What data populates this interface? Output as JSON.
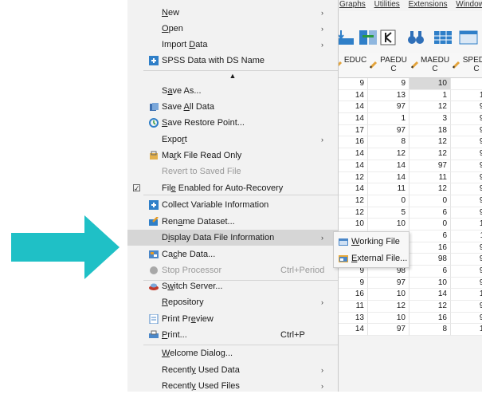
{
  "menu": {
    "items": [
      {
        "label": "New",
        "sub": true
      },
      {
        "label": "Open",
        "sub": true
      },
      {
        "label": "Import Data",
        "sub": true
      },
      {
        "label": "SPSS Data with DS Name",
        "icon": "spss-icon"
      },
      {
        "label": "Save As..."
      },
      {
        "label": "Save All Data",
        "icon": "save-all-icon"
      },
      {
        "label": "Save Restore Point...",
        "icon": "restore-point-icon"
      },
      {
        "label": "Export",
        "sub": true
      },
      {
        "label": "Mark File Read Only",
        "icon": "read-only-icon"
      },
      {
        "label": "Revert to Saved File",
        "disabled": true
      },
      {
        "label": "File Enabled for Auto-Recovery",
        "checked": true
      },
      {
        "label": "Collect Variable Information",
        "icon": "collect-info-icon"
      },
      {
        "label": "Rename Dataset...",
        "icon": "rename-icon"
      },
      {
        "label": "Display Data File Information",
        "sub": true,
        "highlight": true
      },
      {
        "label": "Cache Data...",
        "icon": "cache-icon"
      },
      {
        "label": "Stop Processor",
        "shortcut": "Ctrl+Period",
        "disabled": true,
        "icon": "stop-icon"
      },
      {
        "label": "Switch Server...",
        "icon": "server-icon"
      },
      {
        "label": "Repository",
        "sub": true
      },
      {
        "label": "Print Preview",
        "icon": "print-preview-icon"
      },
      {
        "label": "Print...",
        "shortcut": "Ctrl+P",
        "icon": "print-icon"
      },
      {
        "label": "Welcome Dialog..."
      },
      {
        "label": "Recently Used Data",
        "sub": true
      },
      {
        "label": "Recently Used Files",
        "sub": true
      }
    ],
    "scroll_up_glyph": "▲",
    "submenu_glyph": "›",
    "check_glyph": "☑"
  },
  "submenu": {
    "items": [
      {
        "label": "Working File",
        "icon": "working-file-icon"
      },
      {
        "label": "External File...",
        "icon": "external-file-icon"
      }
    ]
  },
  "background_app": {
    "menubar": [
      "Graphs",
      "Utilities",
      "Extensions",
      "Window"
    ],
    "columns": [
      "EDUC",
      "PAEDUC",
      "MAEDUC",
      "SPEDUC"
    ],
    "rows": [
      [
        "9",
        "9",
        "10",
        "8"
      ],
      [
        "14",
        "13",
        "1",
        "12"
      ],
      [
        "14",
        "97",
        "12",
        "97"
      ],
      [
        "14",
        "1",
        "3",
        "97"
      ],
      [
        "17",
        "97",
        "18",
        "97"
      ],
      [
        "16",
        "8",
        "12",
        "97"
      ],
      [
        "14",
        "12",
        "12",
        "97"
      ],
      [
        "14",
        "14",
        "97",
        "97"
      ],
      [
        "12",
        "14",
        "11",
        "97"
      ],
      [
        "14",
        "11",
        "12",
        "97"
      ],
      [
        "12",
        "0",
        "0",
        "97"
      ],
      [
        "12",
        "5",
        "6",
        "97"
      ],
      [
        "10",
        "10",
        "0",
        "12"
      ],
      [
        "12",
        "10",
        "6",
        "11"
      ],
      [
        "12",
        "12",
        "16",
        "97"
      ],
      [
        "11",
        "98",
        "98",
        "97"
      ],
      [
        "9",
        "98",
        "6",
        "97"
      ],
      [
        "9",
        "97",
        "10",
        "97"
      ],
      [
        "16",
        "10",
        "14",
        "14"
      ],
      [
        "11",
        "12",
        "12",
        "97"
      ],
      [
        "13",
        "10",
        "16",
        "97"
      ],
      [
        "14",
        "97",
        "8",
        "12"
      ]
    ],
    "selected_cell": [
      0,
      2
    ]
  },
  "colors": {
    "arrow": "#1fc0c6",
    "highlight": "#d6d6d6",
    "menu_bg": "#f2f2f2"
  }
}
